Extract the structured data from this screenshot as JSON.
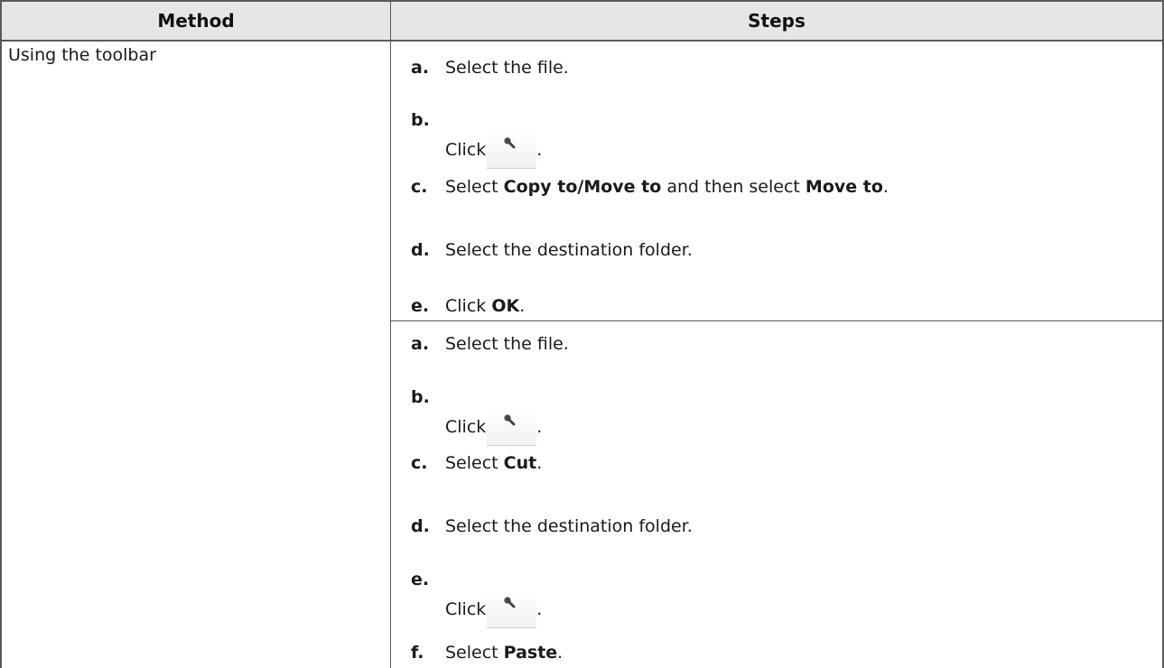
{
  "table": {
    "headers": {
      "method": "Method",
      "steps": "Steps"
    },
    "method_label": "Using the toolbar",
    "group1": {
      "a": {
        "letter": "a.",
        "text": "Select the file."
      },
      "b": {
        "letter": "b.",
        "pre": "Click",
        "post": ".",
        "icon": "wrench-icon"
      },
      "c": {
        "letter": "c.",
        "pre": "Select ",
        "bold1": "Copy to/Move to",
        "mid": " and then select ",
        "bold2": "Move to",
        "post": "."
      },
      "d": {
        "letter": "d.",
        "text": "Select the destination folder."
      },
      "e": {
        "letter": "e.",
        "pre": "Click ",
        "bold": "OK",
        "post": "."
      }
    },
    "group2": {
      "a": {
        "letter": "a.",
        "text": "Select the file."
      },
      "b": {
        "letter": "b.",
        "pre": "Click",
        "post": ".",
        "icon": "wrench-icon"
      },
      "c": {
        "letter": "c.",
        "pre": "Select ",
        "bold": "Cut",
        "post": "."
      },
      "d": {
        "letter": "d.",
        "text": "Select the destination folder."
      },
      "e": {
        "letter": "e.",
        "pre": "Click",
        "post": ".",
        "icon": "wrench-icon"
      },
      "f": {
        "letter": "f.",
        "pre": "Select ",
        "bold": "Paste",
        "post": "."
      }
    }
  }
}
